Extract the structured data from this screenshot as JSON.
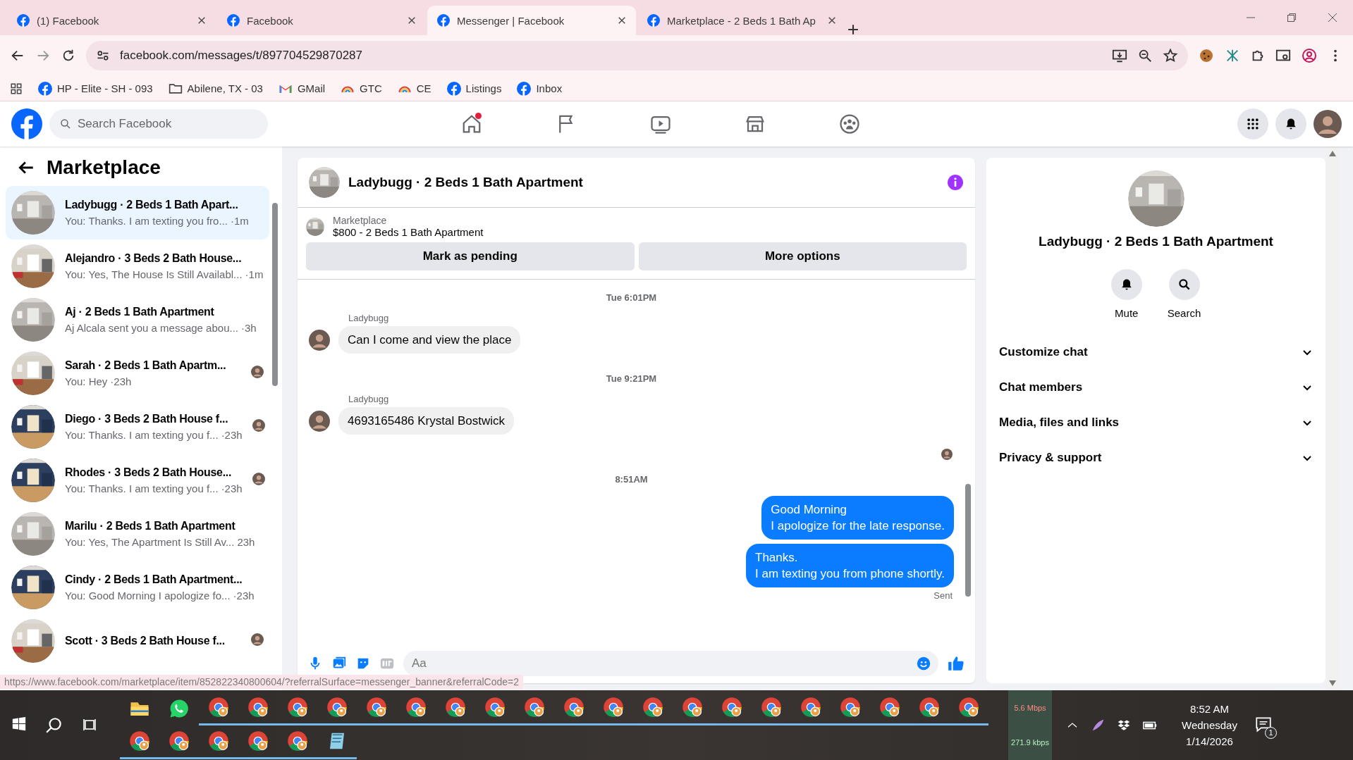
{
  "browser": {
    "tabs": [
      {
        "title": "(1) Facebook",
        "selected": false
      },
      {
        "title": "Facebook",
        "selected": false
      },
      {
        "title": "Messenger | Facebook",
        "selected": true
      },
      {
        "title": "Marketplace - 2 Beds 1 Bath Ap",
        "selected": false
      }
    ],
    "url": "facebook.com/messages/t/897704529870287",
    "bookmarks": [
      {
        "label": "HP - Elite - SH - 093",
        "kind": "facebook"
      },
      {
        "label": "Abilene, TX - 03",
        "kind": "folder"
      },
      {
        "label": "GMail",
        "kind": "mail"
      },
      {
        "label": "GTC",
        "kind": "rainbow"
      },
      {
        "label": "CE",
        "kind": "rainbow"
      },
      {
        "label": "Listings",
        "kind": "facebook"
      },
      {
        "label": "Inbox",
        "kind": "facebook"
      }
    ],
    "status_url": "https://www.facebook.com/marketplace/item/852822340800604/?referralSurface=messenger_banner&referralCode=2"
  },
  "header": {
    "search": {
      "placeholder": "Search Facebook"
    },
    "home_notification": true
  },
  "sidebar": {
    "title": "Marketplace",
    "chats": [
      {
        "title": "Ladybugg · 2 Beds 1 Bath Apart...",
        "preview": "You: Thanks. I am texting you fro...",
        "time": "·1m",
        "selected": true,
        "seen_avatar": false
      },
      {
        "title": "Alejandro · 3 Beds 2 Bath House...",
        "preview": "You: Yes, The House Is Still Availabl...",
        "time": "·1m",
        "selected": false,
        "seen_avatar": false
      },
      {
        "title": "Aj · 2 Beds 1 Bath Apartment",
        "preview": "Aj Alcala sent you a message abou...",
        "time": "·3h",
        "selected": false,
        "seen_avatar": false
      },
      {
        "title": "Sarah · 2 Beds 1 Bath Apartm...",
        "preview": "You: Hey",
        "time": "·23h",
        "selected": false,
        "seen_avatar": true
      },
      {
        "title": "Diego · 3 Beds 2 Bath House f...",
        "preview": "You: Thanks. I am texting you f...",
        "time": "·23h",
        "selected": false,
        "seen_avatar": true
      },
      {
        "title": "Rhodes · 3 Beds 2 Bath House...",
        "preview": "You: Thanks. I am texting you f...",
        "time": "·23h",
        "selected": false,
        "seen_avatar": true
      },
      {
        "title": "Marilu · 2 Beds 1 Bath Apartment",
        "preview": "You: Yes, The Apartment Is Still Av...",
        "time": "23h",
        "selected": false,
        "seen_avatar": false
      },
      {
        "title": "Cindy · 2 Beds 1 Bath Apartment...",
        "preview": "You: Good Morning I apologize fo...",
        "time": "·23h",
        "selected": false,
        "seen_avatar": false
      },
      {
        "title": "Scott · 3 Beds 2 Bath House f...",
        "selected": false,
        "seen_avatar": true
      }
    ]
  },
  "chat": {
    "title": "Ladybugg · 2 Beds 1 Bath Apartment",
    "listing": {
      "source": "Marketplace",
      "name": "$800 - 2 Beds 1 Bath Apartment"
    },
    "actions": [
      "Mark as pending",
      "More options"
    ],
    "messages": [
      {
        "kind": "time",
        "text": "Tue 6:01PM"
      },
      {
        "kind": "incoming",
        "sender": "Ladybugg",
        "lines": [
          "Can I come and view the place"
        ]
      },
      {
        "kind": "time",
        "text": "Tue 9:21PM"
      },
      {
        "kind": "incoming",
        "sender": "Ladybugg",
        "lines": [
          "4693165486 Krystal Bostwick"
        ]
      },
      {
        "kind": "seen"
      },
      {
        "kind": "time",
        "text": "8:51AM"
      },
      {
        "kind": "outgoing",
        "lines": [
          "Good Morning",
          "I apologize for the late response."
        ]
      },
      {
        "kind": "outgoing",
        "lines": [
          "Thanks.",
          "I am texting you from phone shortly."
        ]
      },
      {
        "kind": "status",
        "text": "Sent"
      }
    ],
    "composer": {
      "placeholder": "Aa"
    }
  },
  "details": {
    "title": "Ladybugg · 2 Beds 1 Bath Apartment",
    "actions": [
      {
        "label": "Mute",
        "kind": "bell"
      },
      {
        "label": "Search",
        "kind": "search"
      }
    ],
    "sections": [
      {
        "label": "Customize chat",
        "expanded": false
      },
      {
        "label": "Chat members",
        "expanded": false
      },
      {
        "label": "Media, files and links",
        "expanded": false
      },
      {
        "label": "Privacy & support",
        "expanded": false
      }
    ]
  },
  "taskbar": {
    "network": {
      "down": "5.6 Mbps",
      "up": "271.9 kbps"
    },
    "time": "8:52 AM",
    "day": "Wednesday",
    "date": "1/14/2026",
    "notifications": "1",
    "apps": [
      {
        "kind": "files",
        "running": false
      },
      {
        "kind": "chat",
        "running": false
      },
      {
        "kind": "browser",
        "running": true
      },
      {
        "kind": "browser",
        "running": true
      },
      {
        "kind": "browser",
        "running": true
      },
      {
        "kind": "browser",
        "running": true
      },
      {
        "kind": "browser",
        "running": true
      },
      {
        "kind": "browser",
        "running": true
      },
      {
        "kind": "browser",
        "running": true
      },
      {
        "kind": "browser",
        "running": true
      },
      {
        "kind": "browser",
        "running": true
      },
      {
        "kind": "browser",
        "running": true
      },
      {
        "kind": "browser",
        "running": true
      },
      {
        "kind": "browser",
        "running": true
      },
      {
        "kind": "browser",
        "running": true
      },
      {
        "kind": "browser",
        "running": true
      },
      {
        "kind": "browser",
        "running": true
      },
      {
        "kind": "browser",
        "running": true
      },
      {
        "kind": "browser",
        "running": true
      },
      {
        "kind": "browser",
        "running": true
      },
      {
        "kind": "browser",
        "running": true
      },
      {
        "kind": "browser",
        "running": true
      },
      {
        "kind": "browser",
        "running": true
      },
      {
        "kind": "browser",
        "running": true
      },
      {
        "kind": "browser",
        "running": true
      },
      {
        "kind": "browser",
        "running": true
      },
      {
        "kind": "browser",
        "running": true
      },
      {
        "kind": "notes",
        "running": true
      }
    ]
  }
}
